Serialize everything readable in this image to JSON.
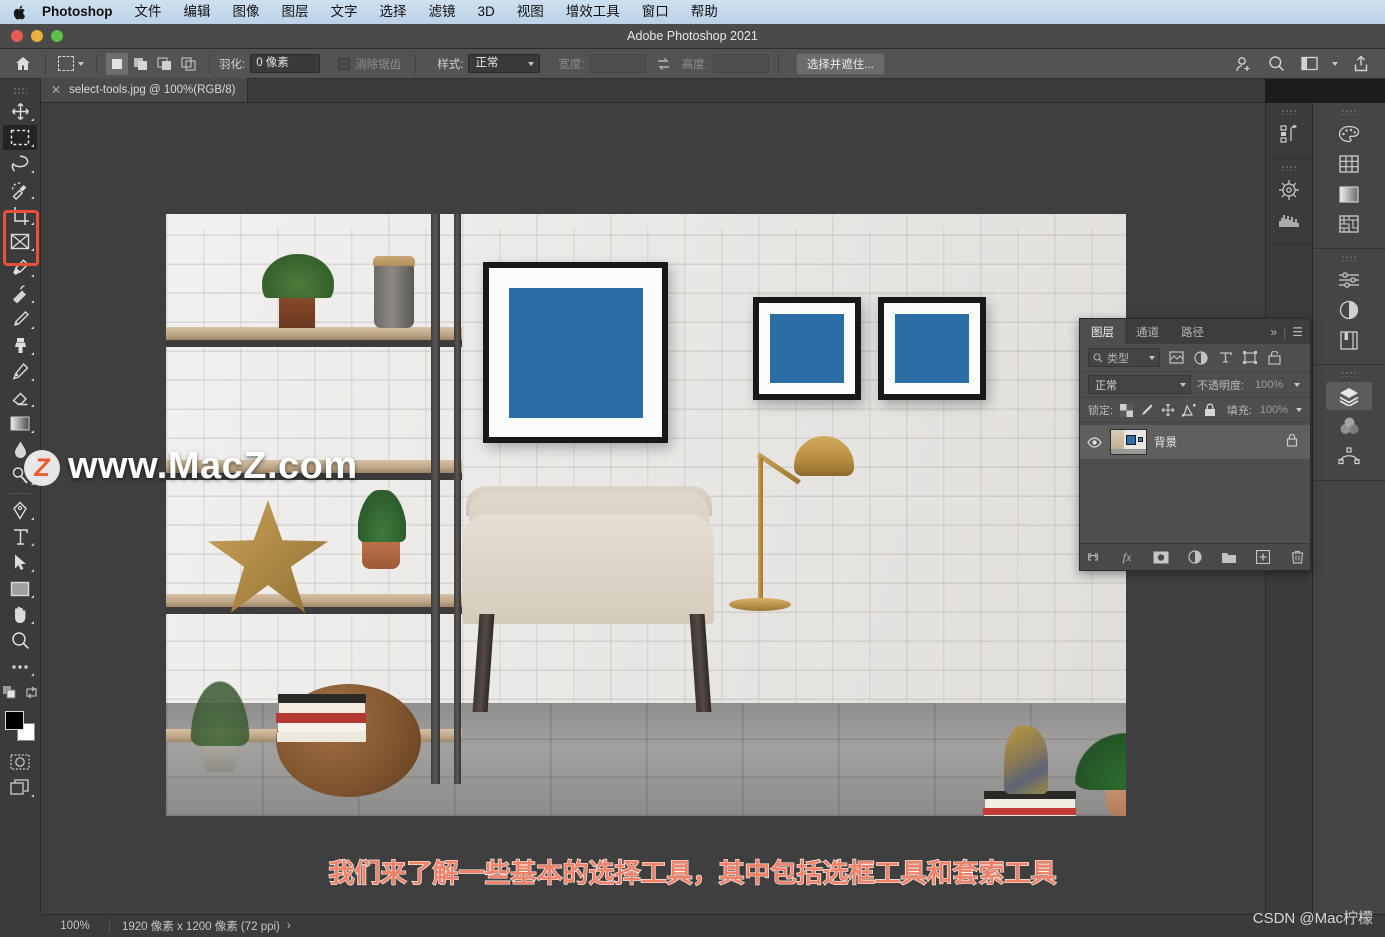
{
  "macmenu": {
    "apple_icon": "apple-logo-icon",
    "items": [
      "Photoshop",
      "文件",
      "编辑",
      "图像",
      "图层",
      "文字",
      "选择",
      "滤镜",
      "3D",
      "视图",
      "增效工具",
      "窗口",
      "帮助"
    ]
  },
  "titlebar": {
    "title": "Adobe Photoshop 2021"
  },
  "options": {
    "home_icon": "home-icon",
    "tool_preset_icon": "rectangular-marquee-icon",
    "bool_modes": [
      "new-selection-icon",
      "add-to-selection-icon",
      "subtract-from-selection-icon",
      "intersect-selection-icon"
    ],
    "feather_label": "羽化:",
    "feather_value": "0 像素",
    "antialias_label": "消除锯齿",
    "style_label": "样式:",
    "style_value": "正常",
    "width_label": "宽度:",
    "width_value": "",
    "swap_icon": "swap-dimensions-icon",
    "height_label": "高度:",
    "height_value": "",
    "select_mask_button": "选择并遮住...",
    "right_icons": [
      "account-icon",
      "search-icon",
      "workspace-icon",
      "workspace-caret-icon",
      "share-icon"
    ]
  },
  "tab": {
    "close_icon": "close-icon",
    "label": "select-tools.jpg @ 100%(RGB/8)"
  },
  "toolbar": {
    "tools": [
      {
        "name": "move-tool",
        "selected": false
      },
      {
        "name": "rectangular-marquee-tool",
        "selected": true
      },
      {
        "name": "lasso-tool",
        "selected": false
      },
      {
        "name": "quick-selection-tool",
        "selected": false
      },
      {
        "name": "crop-tool",
        "selected": false
      },
      {
        "name": "frame-tool",
        "selected": false
      },
      {
        "name": "eyedropper-tool",
        "selected": false
      },
      {
        "name": "spot-healing-brush-tool",
        "selected": false
      },
      {
        "name": "brush-tool",
        "selected": false
      },
      {
        "name": "clone-stamp-tool",
        "selected": false
      },
      {
        "name": "history-brush-tool",
        "selected": false
      },
      {
        "name": "eraser-tool",
        "selected": false
      },
      {
        "name": "gradient-tool",
        "selected": false
      },
      {
        "name": "blur-tool",
        "selected": false
      },
      {
        "name": "dodge-tool",
        "selected": false
      },
      {
        "name": "pen-tool",
        "selected": false
      },
      {
        "name": "type-tool",
        "selected": false
      },
      {
        "name": "path-selection-tool",
        "selected": false
      },
      {
        "name": "rectangle-tool",
        "selected": false
      },
      {
        "name": "hand-tool",
        "selected": false
      },
      {
        "name": "zoom-tool",
        "selected": false
      },
      {
        "name": "edit-toolbar-tool",
        "selected": false
      }
    ],
    "highlight_color": "#e8503a",
    "foreground_color": "#000000",
    "background_color": "#ffffff",
    "quickmask_icon": "quick-mask-icon",
    "screenmode_icon": "screen-mode-icon"
  },
  "layers_panel": {
    "tabs": [
      {
        "label": "图层",
        "active": true
      },
      {
        "label": "通道",
        "active": false
      },
      {
        "label": "路径",
        "active": false
      }
    ],
    "collapse_icon": "double-chevron-icon",
    "menu_icon": "panel-menu-icon",
    "filter": {
      "search_icon": "search-icon",
      "type_label": "类型",
      "icons": [
        "filter-pixel-icon",
        "filter-adjustment-icon",
        "filter-type-icon",
        "filter-shape-icon",
        "filter-smart-icon"
      ],
      "toggle_icon": "filter-toggle-icon"
    },
    "blend_mode": "正常",
    "opacity_label": "不透明度:",
    "opacity_value": "100%",
    "lock_label": "锁定:",
    "lock_icons": [
      "lock-transparent-icon",
      "lock-image-icon",
      "lock-position-icon",
      "lock-artboard-icon",
      "lock-all-icon"
    ],
    "fill_label": "填充:",
    "fill_value": "100%",
    "rows": [
      {
        "name": "背景",
        "eye_icon": "eye-icon",
        "lock_icon": "lock-icon",
        "selected": true
      }
    ],
    "footer_icons": [
      "link-layers-icon",
      "layer-style-icon",
      "layer-mask-icon",
      "adjustment-layer-icon",
      "new-group-icon",
      "new-layer-icon",
      "delete-layer-icon"
    ]
  },
  "right_rail": {
    "groups": [
      {
        "icons": [
          "history-icon"
        ]
      },
      {
        "icons": [
          "navigator-icon",
          "histogram-icon"
        ]
      }
    ],
    "outer_groups": [
      {
        "icons": [
          "color-palette-icon",
          "swatches-icon",
          "gradients-icon",
          "patterns-icon"
        ]
      },
      {
        "icons": [
          "adjustments-icon",
          "adjustment-half-icon",
          "libraries-icon"
        ]
      },
      {
        "icons": [
          "layers-icon",
          "channels-icon",
          "paths-icon"
        ],
        "active_index": 0
      }
    ]
  },
  "statusbar": {
    "zoom": "100%",
    "dimensions": "1920 像素 x 1200 像素 (72 ppi)",
    "expand_icon": "chevron-right-icon"
  },
  "subtitle": {
    "text": "我们来了解一些基本的选择工具，其中包括选框工具和套索工具",
    "color": "#f08268"
  },
  "watermark": {
    "site": "www.MacZ.com",
    "badge": "Z",
    "csdn": "CSDN @Mac柠檬"
  },
  "canvas": {
    "document": "select-tools.jpg",
    "scene_description": "室内场景：白砖墙、木架、装框海景照片、米色扶手椅、黄铜台灯、木质长桌"
  }
}
